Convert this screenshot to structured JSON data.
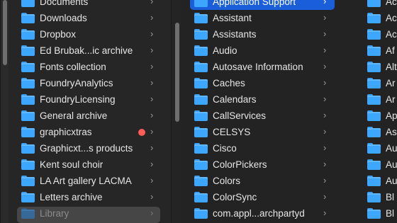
{
  "column1": {
    "items": [
      {
        "label": "Documents",
        "type": "folder"
      },
      {
        "label": "Downloads",
        "type": "folder"
      },
      {
        "label": "Dropbox",
        "type": "folder"
      },
      {
        "label": "Ed Brubak...ic archive",
        "type": "folder"
      },
      {
        "label": "Fonts collection",
        "type": "folder"
      },
      {
        "label": "FoundryAnalytics",
        "type": "folder"
      },
      {
        "label": "FoundryLicensing",
        "type": "folder"
      },
      {
        "label": "General archive",
        "type": "folder"
      },
      {
        "label": "graphicxtras",
        "type": "folder",
        "tag_color": "#ff5c57"
      },
      {
        "label": "Graphicxt...s products",
        "type": "folder"
      },
      {
        "label": "Kent soul choir",
        "type": "folder"
      },
      {
        "label": "LA Art gallery LACMA",
        "type": "folder"
      },
      {
        "label": "Letters archive",
        "type": "folder"
      },
      {
        "label": "Library",
        "type": "folder",
        "state": "highlighted-inactive"
      }
    ]
  },
  "column2": {
    "items": [
      {
        "label": "Application Support",
        "state": "selected"
      },
      {
        "label": "Assistant"
      },
      {
        "label": "Assistants"
      },
      {
        "label": "Audio"
      },
      {
        "label": "Autosave Information"
      },
      {
        "label": "Caches"
      },
      {
        "label": "Calendars"
      },
      {
        "label": "CallServices"
      },
      {
        "label": "CELSYS"
      },
      {
        "label": "Cisco"
      },
      {
        "label": "ColorPickers"
      },
      {
        "label": "Colors"
      },
      {
        "label": "ColorSync"
      },
      {
        "label": "com.appl...archpartyd"
      }
    ]
  },
  "column3": {
    "items": [
      {
        "label": "Ac"
      },
      {
        "label": "Ac"
      },
      {
        "label": "Ac"
      },
      {
        "label": "Af"
      },
      {
        "label": "Alt"
      },
      {
        "label": "Ar"
      },
      {
        "label": "Ar"
      },
      {
        "label": "Ap"
      },
      {
        "label": "As"
      },
      {
        "label": "Au"
      },
      {
        "label": "Au"
      },
      {
        "label": "Au"
      },
      {
        "label": "Bl"
      },
      {
        "label": "Bl"
      }
    ]
  },
  "icons": {
    "folder": "folder-icon",
    "chevron": "chevron-right-icon"
  },
  "glyphs": {
    "chevron": "›"
  },
  "colors": {
    "selection": "#1a5fd9",
    "folder": "#3da6ff",
    "tag_red": "#ff5c57"
  }
}
